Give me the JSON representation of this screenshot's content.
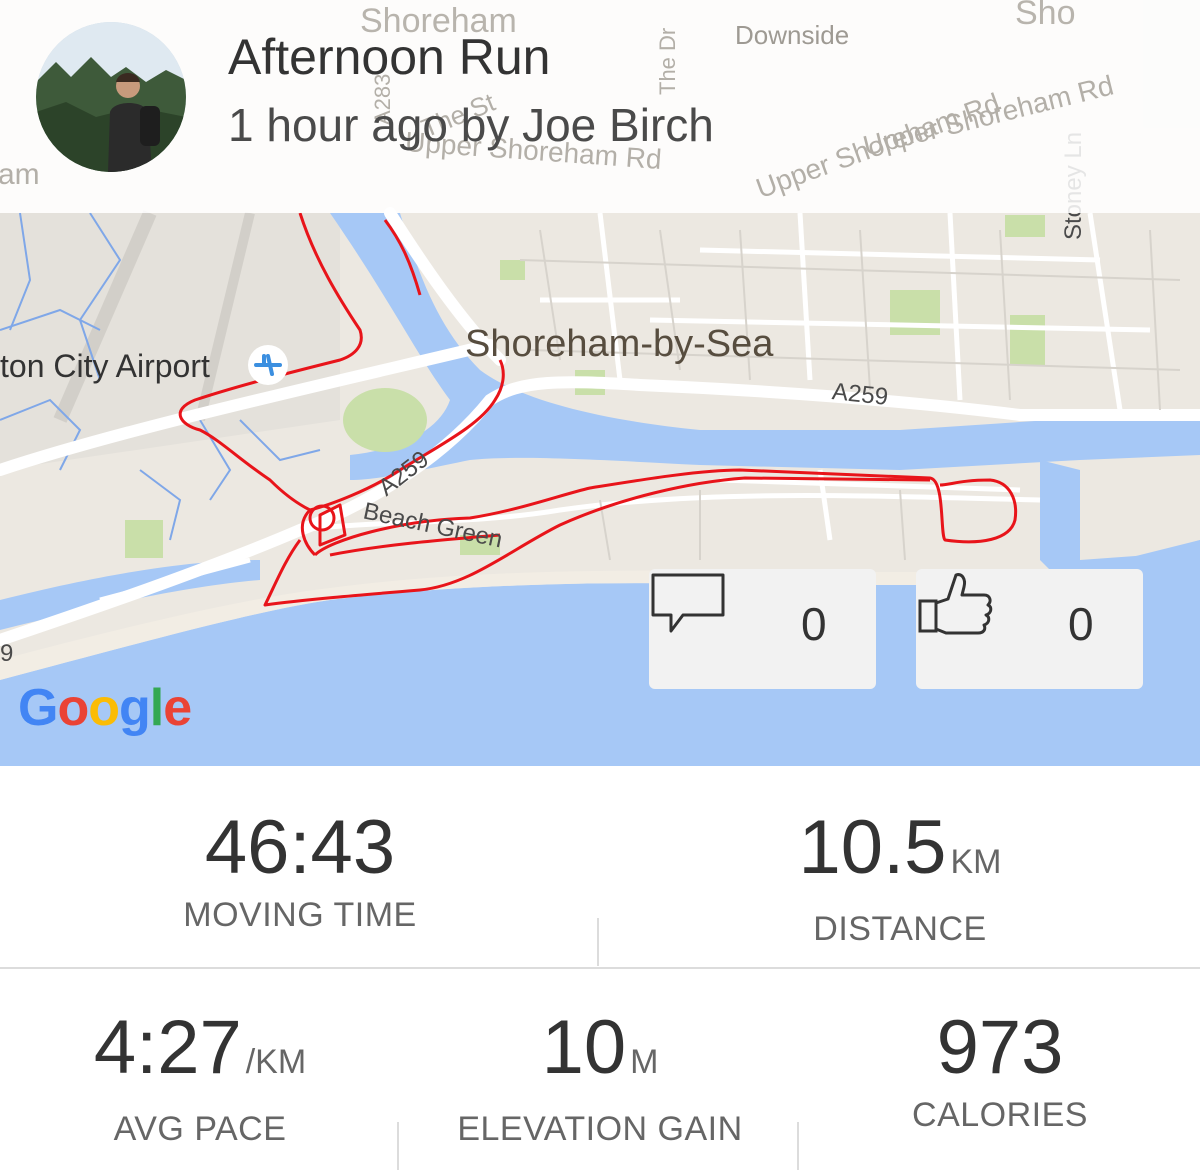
{
  "activity": {
    "title": "Afternoon Run",
    "subtitle": "1 hour ago by Joe Birch"
  },
  "map": {
    "labels": {
      "airport": "ton City Airport",
      "town": "Shoreham-by-Sea",
      "road_a259_east": "A259",
      "road_a259_west": "A259",
      "beach_green": "Beach Green",
      "upper_shoreham_rd_1": "Upper Shoreham Rd",
      "upper_shoreham_rd_2": "Upper Shoreham Rd",
      "upper_shoreham_rd_3": "Upper Shoreham Rd",
      "downside": "Downside",
      "stoney_ln": "Stoney Ln",
      "a283": "A283",
      "the_st": "The St",
      "the_dr": "The Dr",
      "shoreham_top": "Shoreham",
      "shoreham_top_right": "Sho",
      "ham_left": "am",
      "road_9": "9"
    },
    "attribution": "Google",
    "route_color": "#e8141a"
  },
  "social": {
    "comments": {
      "icon": "comment-icon",
      "count": "0"
    },
    "kudos": {
      "icon": "thumbs-up-icon",
      "count": "0"
    }
  },
  "stats": {
    "moving_time": {
      "value": "46:43",
      "label": "MOVING TIME"
    },
    "distance": {
      "value": "10.5",
      "unit": "KM",
      "label": "DISTANCE"
    },
    "avg_pace": {
      "value": "4:27",
      "unit": "/KM",
      "label": "AVG PACE"
    },
    "elevation_gain": {
      "value": "10",
      "unit": "M",
      "label": "ELEVATION GAIN"
    },
    "calories": {
      "value": "973",
      "label": "CALORIES"
    }
  }
}
